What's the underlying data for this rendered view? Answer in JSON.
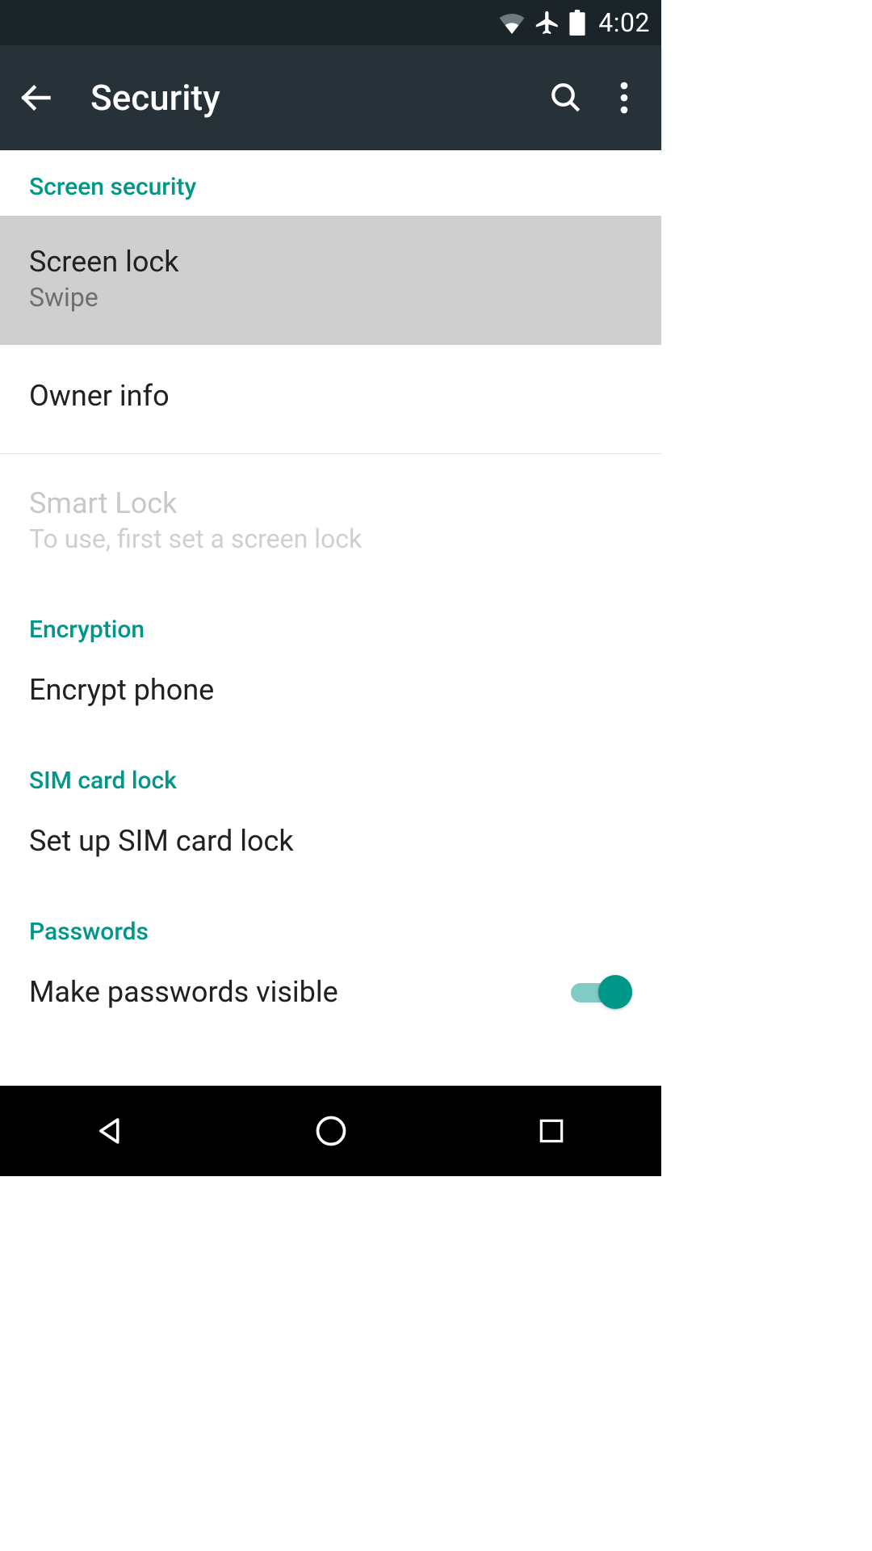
{
  "status_bar": {
    "time": "4:02"
  },
  "app_bar": {
    "title": "Security"
  },
  "sections": {
    "screen_security": {
      "header": "Screen security",
      "screen_lock": {
        "title": "Screen lock",
        "sub": "Swipe"
      },
      "owner_info": {
        "title": "Owner info"
      },
      "smart_lock": {
        "title": "Smart Lock",
        "sub": "To use, first set a screen lock"
      }
    },
    "encryption": {
      "header": "Encryption",
      "encrypt_phone": {
        "title": "Encrypt phone"
      }
    },
    "sim": {
      "header": "SIM card lock",
      "setup": {
        "title": "Set up SIM card lock"
      }
    },
    "passwords": {
      "header": "Passwords",
      "visible": {
        "title": "Make passwords visible",
        "value": true
      }
    }
  }
}
